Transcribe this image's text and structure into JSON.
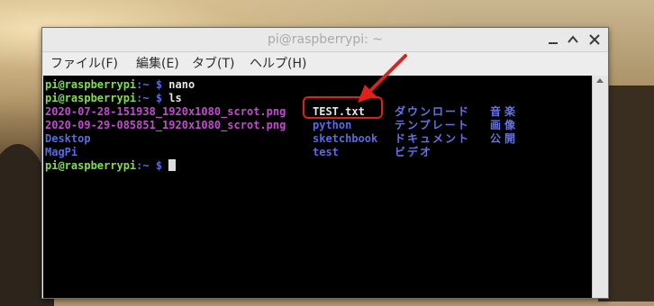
{
  "window": {
    "title": "pi@raspberrypi: ~"
  },
  "menu": {
    "items": [
      {
        "label": "ファイル(F)"
      },
      {
        "label": "編集(E)"
      },
      {
        "label": "タブ(T)"
      },
      {
        "label": "ヘルプ(H)"
      }
    ]
  },
  "terminal": {
    "prompt": "pi@raspberrypi",
    "prompt_path": ":~ $",
    "commands": [
      "nano",
      "ls"
    ],
    "ls_files": [
      "2020-07-28-151938_1920x1080_scrot.png",
      "2020-09-29-085851_1920x1080_scrot.png"
    ],
    "ls_dirs_col1": [
      "Desktop",
      "MagPi"
    ],
    "ls_col2": [
      "TEST.txt",
      "python",
      "sketchbook",
      "test"
    ],
    "ls_col3": [
      "ダウンロード",
      "テンプレート",
      "ドキュメント",
      "ビデオ"
    ],
    "ls_col4": [
      "音楽",
      "画像",
      "公開"
    ]
  },
  "colors": {
    "prompt_green": "#7fe04a",
    "dir_blue": "#5a6ae0",
    "image_magenta": "#c44ad2",
    "annotation_red": "#e0201c"
  },
  "icons": [
    "minimize-icon",
    "maximize-icon",
    "close-icon",
    "scroll-up-arrow-icon"
  ]
}
